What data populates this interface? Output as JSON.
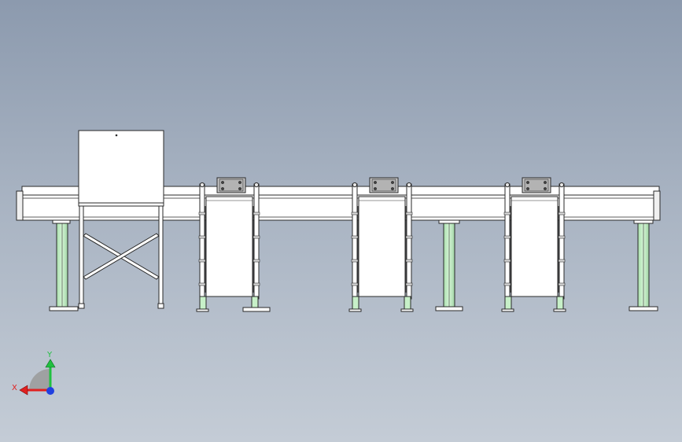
{
  "viewport": {
    "background_top": "#8c9aae",
    "background_bottom": "#c4ccd6"
  },
  "model": {
    "frame_color": "#ffffff",
    "support_color": "#c7f0c8",
    "outline_color": "#2a2a2a",
    "rail_shadow": "#cfcfcf",
    "module_count": 3,
    "support_leg_count": 3
  },
  "triad": {
    "x_label": "X",
    "y_label": "Y",
    "x_color": "#e02020",
    "y_color": "#20c040",
    "z_color": "#2040e0"
  }
}
